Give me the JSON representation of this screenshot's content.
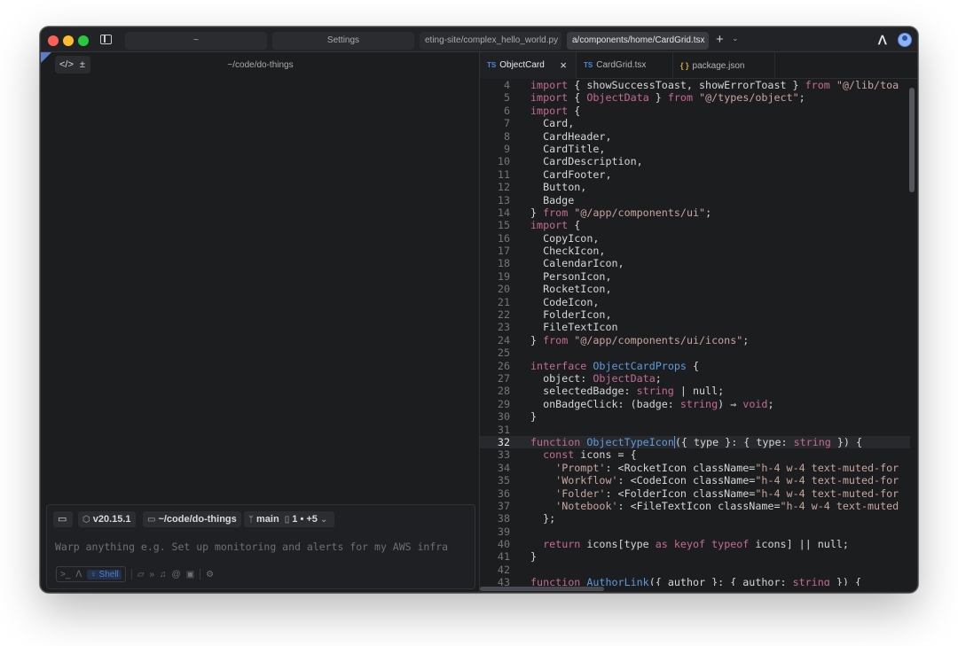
{
  "window": {
    "tabs": [
      {
        "label": "~",
        "active": false
      },
      {
        "label": "Settings",
        "active": false
      },
      {
        "label": "eting-site/complex_hello_world.py",
        "active": false
      },
      {
        "label": "a/components/home/CardGrid.tsx",
        "active": true
      }
    ],
    "new_tab": "+",
    "tab_menu": "⌄",
    "brand": "ᐱ"
  },
  "left_pane": {
    "path": "~/code/do-things",
    "tools": [
      "</>",
      "±"
    ],
    "input": {
      "chips": {
        "node_version": "v20.15.1",
        "directory": "~/code/do-things",
        "branch": "main",
        "changes": "1 • +5"
      },
      "placeholder": "Warp anything e.g. Set up monitoring and alerts for my AWS infra",
      "mode_label": "Shell"
    }
  },
  "editor": {
    "tabs": [
      {
        "badge": "TS",
        "label": "ObjectCard",
        "active": true,
        "close": "×"
      },
      {
        "badge": "TS",
        "label": "CardGrid.tsx",
        "active": false
      },
      {
        "badge": "{ }",
        "label": "package.json",
        "active": false
      }
    ],
    "current_line": "32",
    "lines": [
      {
        "n": "4",
        "t": "import { showSuccessToast, showErrorToast } from \"@/lib/toa"
      },
      {
        "n": "5",
        "t": "import { ObjectData } from \"@/types/object\";"
      },
      {
        "n": "6",
        "t": "import {"
      },
      {
        "n": "7",
        "t": "  Card,"
      },
      {
        "n": "8",
        "t": "  CardHeader,"
      },
      {
        "n": "9",
        "t": "  CardTitle,"
      },
      {
        "n": "10",
        "t": "  CardDescription,"
      },
      {
        "n": "11",
        "t": "  CardFooter,"
      },
      {
        "n": "12",
        "t": "  Button,"
      },
      {
        "n": "13",
        "t": "  Badge"
      },
      {
        "n": "14",
        "t": "} from \"@/app/components/ui\";"
      },
      {
        "n": "15",
        "t": "import {"
      },
      {
        "n": "16",
        "t": "  CopyIcon,"
      },
      {
        "n": "17",
        "t": "  CheckIcon,"
      },
      {
        "n": "18",
        "t": "  CalendarIcon,"
      },
      {
        "n": "19",
        "t": "  PersonIcon,"
      },
      {
        "n": "20",
        "t": "  RocketIcon,"
      },
      {
        "n": "21",
        "t": "  CodeIcon,"
      },
      {
        "n": "22",
        "t": "  FolderIcon,"
      },
      {
        "n": "23",
        "t": "  FileTextIcon"
      },
      {
        "n": "24",
        "t": "} from \"@/app/components/ui/icons\";"
      },
      {
        "n": "25",
        "t": ""
      },
      {
        "n": "26",
        "t": "interface ObjectCardProps {"
      },
      {
        "n": "27",
        "t": "  object: ObjectData;"
      },
      {
        "n": "28",
        "t": "  selectedBadge: string | null;"
      },
      {
        "n": "29",
        "t": "  onBadgeClick: (badge: string) ⇒ void;"
      },
      {
        "n": "30",
        "t": "}"
      },
      {
        "n": "31",
        "t": ""
      },
      {
        "n": "32",
        "t": "function ObjectTypeIcon({ type }: { type: string }) {"
      },
      {
        "n": "33",
        "t": "  const icons = {"
      },
      {
        "n": "34",
        "t": "    'Prompt': <RocketIcon className=\"h-4 w-4 text-muted-for"
      },
      {
        "n": "35",
        "t": "    'Workflow': <CodeIcon className=\"h-4 w-4 text-muted-for"
      },
      {
        "n": "36",
        "t": "    'Folder': <FolderIcon className=\"h-4 w-4 text-muted-for"
      },
      {
        "n": "37",
        "t": "    'Notebook': <FileTextIcon className=\"h-4 w-4 text-muted"
      },
      {
        "n": "38",
        "t": "  };"
      },
      {
        "n": "39",
        "t": ""
      },
      {
        "n": "40",
        "t": "  return icons[type as keyof typeof icons] || null;"
      },
      {
        "n": "41",
        "t": "}"
      },
      {
        "n": "42",
        "t": ""
      },
      {
        "n": "43",
        "t": "function AuthorLink({ author }: { author: string }) {"
      }
    ]
  },
  "colors": {
    "keyword": "#c46a94",
    "string": "#c8a6a0",
    "function": "#5d9be0",
    "accent": "#4f7cc9"
  }
}
